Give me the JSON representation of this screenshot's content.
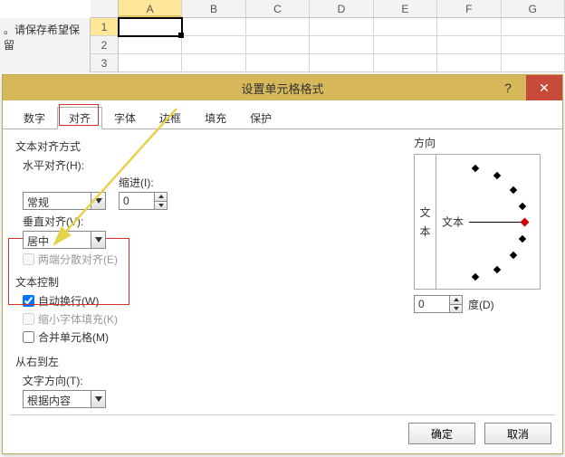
{
  "sheet": {
    "left_note": "。请保存希望保留",
    "cols": [
      "A",
      "B",
      "C",
      "D",
      "E",
      "F",
      "G"
    ],
    "rows": [
      "1",
      "2",
      "3"
    ],
    "active_col_index": 0,
    "active_row_index": 0
  },
  "dialog": {
    "title": "设置单元格格式",
    "help_icon": "?",
    "close_icon": "✕",
    "tabs": [
      "数字",
      "对齐",
      "字体",
      "边框",
      "填充",
      "保护"
    ],
    "active_tab_index": 1,
    "alignment": {
      "group_title": "文本对齐方式",
      "horizontal_label": "水平对齐(H):",
      "horizontal_value": "常规",
      "indent_label": "缩进(I):",
      "indent_value": "0",
      "vertical_label": "垂直对齐(V):",
      "vertical_value": "居中",
      "justify_distributed_label": "两端分散对齐(E)",
      "justify_distributed_checked": false,
      "justify_distributed_disabled": true
    },
    "text_control": {
      "group_title": "文本控制",
      "wrap_label": "自动换行(W)",
      "wrap_checked": true,
      "shrink_label": "缩小字体填充(K)",
      "shrink_checked": false,
      "shrink_disabled": true,
      "merge_label": "合并单元格(M)",
      "merge_checked": false
    },
    "rtl": {
      "group_title": "从右到左",
      "direction_label": "文字方向(T):",
      "direction_value": "根据内容"
    },
    "orientation": {
      "group_title": "方向",
      "vertical_text_chars": [
        "文",
        "本"
      ],
      "pointer_label": "文本",
      "degrees_value": "0",
      "degrees_label": "度(D)"
    },
    "buttons": {
      "ok": "确定",
      "cancel": "取消"
    }
  }
}
